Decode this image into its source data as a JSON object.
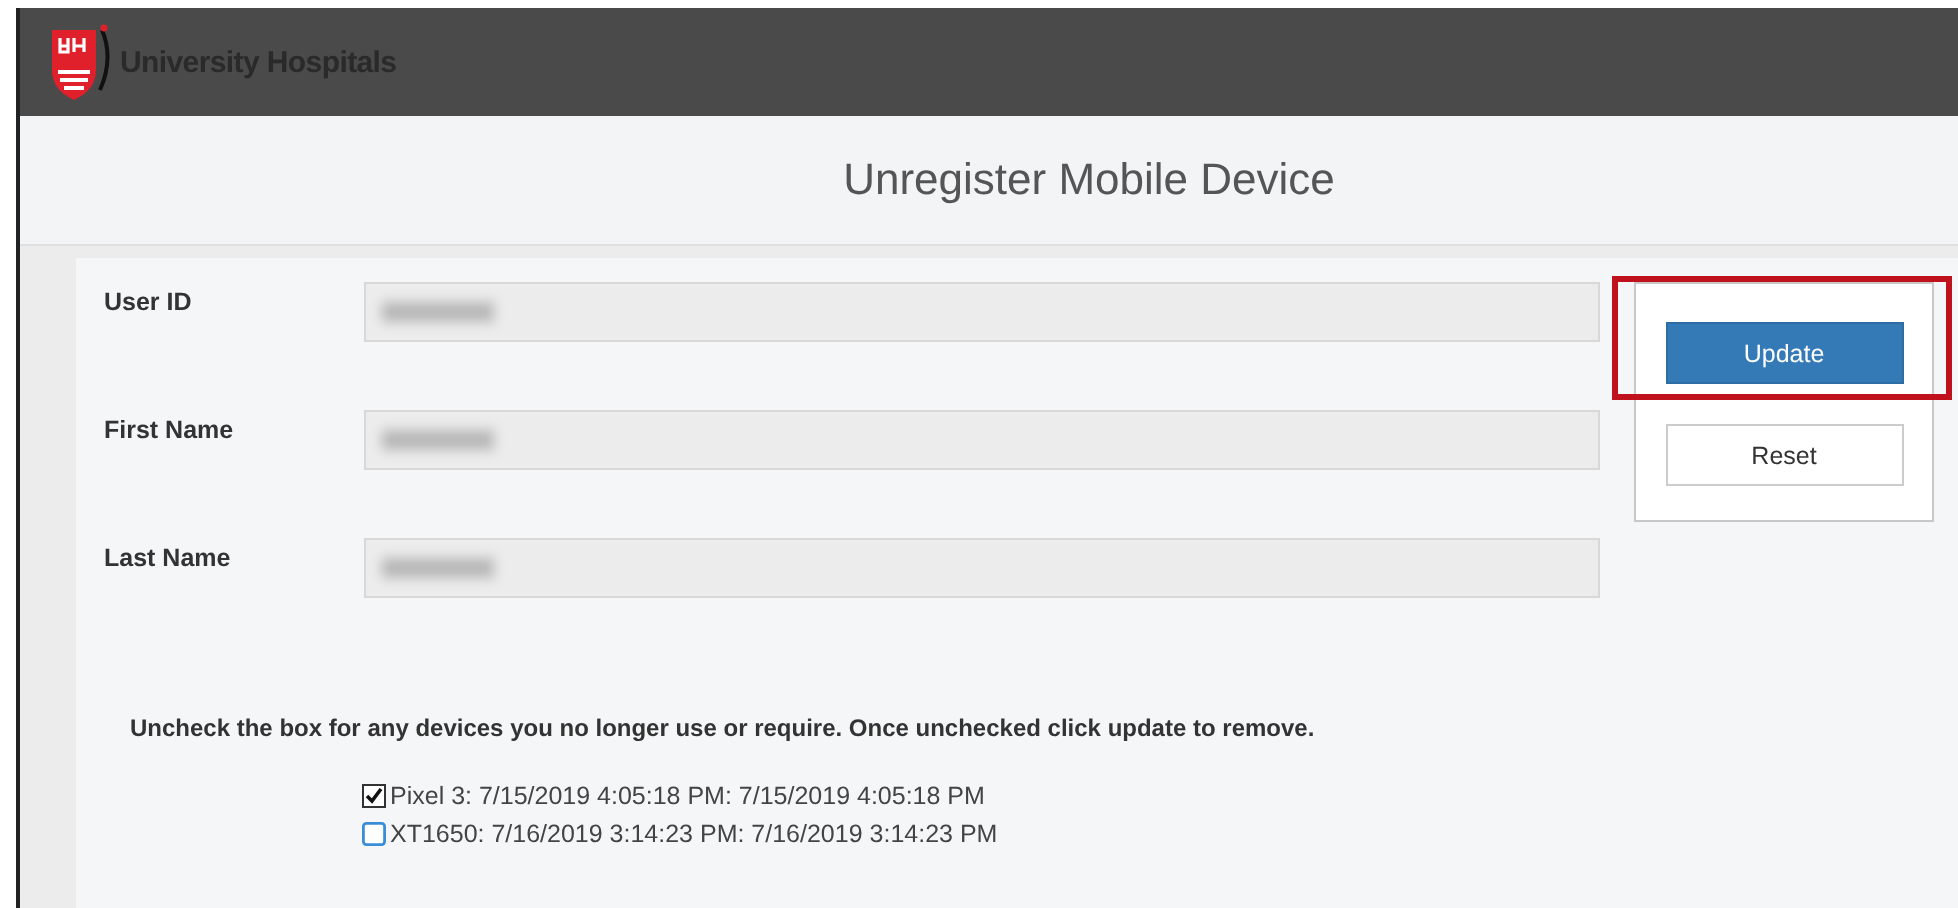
{
  "header": {
    "brand": "University Hospitals"
  },
  "page_title": "Unregister Mobile Device",
  "fields": [
    {
      "label": "User ID",
      "redacted": true
    },
    {
      "label": "First Name",
      "redacted": true
    },
    {
      "label": "Last Name",
      "redacted": true
    }
  ],
  "buttons": [
    {
      "label": "Update",
      "kind": "primary",
      "highlighted": true
    },
    {
      "label": "Reset",
      "kind": "secondary",
      "highlighted": false
    }
  ],
  "instruction": "Uncheck the box for any devices you no longer use or require. Once unchecked click update to remove.",
  "devices": [
    {
      "label": "Pixel 3: 7/15/2019 4:05:18 PM: 7/15/2019 4:05:18 PM",
      "checked": true
    },
    {
      "label": "XT1650: 7/16/2019 3:14:23 PM: 7/16/2019 3:14:23 PM",
      "checked": false
    }
  ]
}
